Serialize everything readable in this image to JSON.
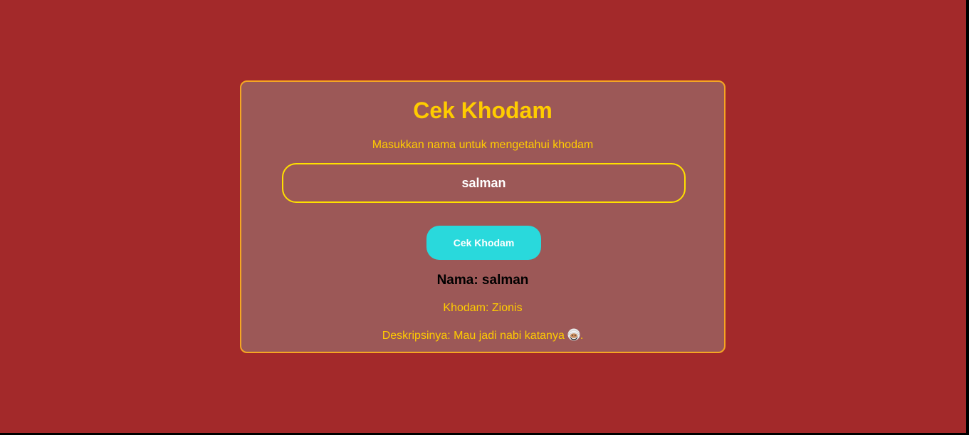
{
  "app": {
    "title": "Cek Khodam",
    "subtitle": "Masukkan nama untuk mengetahui khodam"
  },
  "form": {
    "name_value": "salman",
    "button_label": "Cek Khodam"
  },
  "result": {
    "name_line": "Nama: salman",
    "khodam_line": "Khodam: Zionis",
    "description_text": "Deskripsinya: Mau jadi nabi katanya",
    "description_suffix": ".",
    "description_icon": "bearded-face-emoji-icon"
  },
  "colors": {
    "background": "#a3292a",
    "card": "#9c5857",
    "card_border": "#f5a623",
    "accent_text": "#ffcc00",
    "input_border": "#ffe000",
    "button": "#29d9dc"
  }
}
